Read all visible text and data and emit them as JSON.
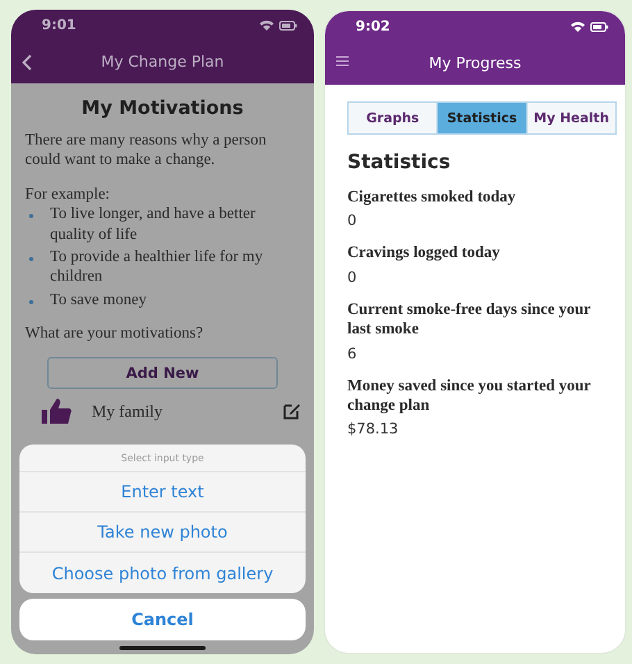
{
  "left_screen": {
    "status_bar": {
      "time": "9:01"
    },
    "header": {
      "title": "My Change Plan"
    },
    "heading": "My Motivations",
    "intro": "There are many reasons why a person could want to make a change.",
    "example_label": "For example:",
    "examples": [
      "To live longer, and have a better quality of life",
      "To provide a healthier life for my children",
      "To save money"
    ],
    "question": "What are your motivations?",
    "add_button": "Add New",
    "motivations": [
      {
        "label": "My family"
      }
    ],
    "action_sheet": {
      "title": "Select input type",
      "options": [
        "Enter text",
        "Take new photo",
        "Choose photo from gallery"
      ],
      "cancel": "Cancel"
    }
  },
  "right_screen": {
    "status_bar": {
      "time": "9:02"
    },
    "header": {
      "title": "My Progress"
    },
    "tabs": [
      {
        "label": "Graphs",
        "selected": false
      },
      {
        "label": "Statistics",
        "selected": true
      },
      {
        "label": "My Health",
        "selected": false
      }
    ],
    "heading": "Statistics",
    "stats": [
      {
        "label": "Cigarettes smoked today",
        "value": "0"
      },
      {
        "label": "Cravings logged today",
        "value": "0"
      },
      {
        "label": "Current smoke-free days since your last smoke",
        "value": "6"
      },
      {
        "label": "Money saved since you started your change plan",
        "value": "$78.13"
      }
    ]
  }
}
